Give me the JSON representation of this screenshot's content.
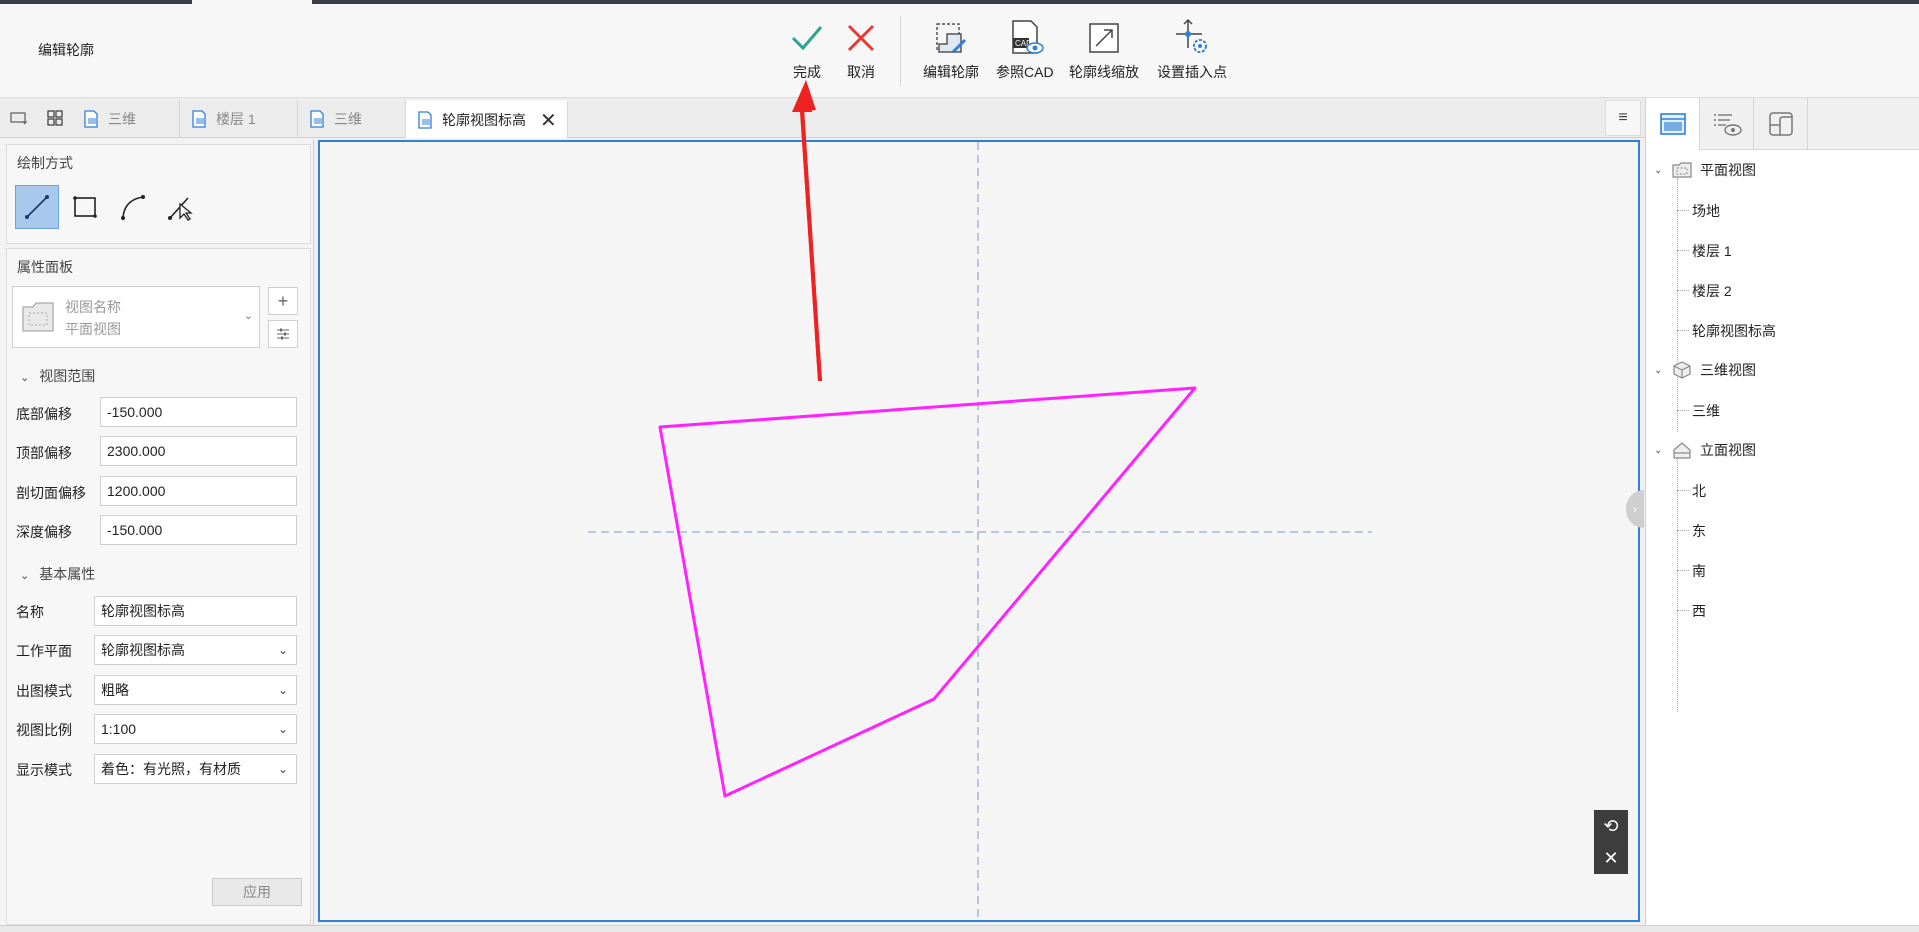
{
  "toolbar": {
    "context_title": "编辑轮廓",
    "finish_label": "完成",
    "cancel_label": "取消",
    "edit_profile_label": "编辑轮廓",
    "ref_cad_label": "参照CAD",
    "scale_profile_label": "轮廓线缩放",
    "set_insert_point_label": "设置插入点"
  },
  "tabs": [
    {
      "label": "三维"
    },
    {
      "label": "楼层 1"
    },
    {
      "label": "三维"
    },
    {
      "label": "轮廓视图标高"
    }
  ],
  "left_panel": {
    "draw_mode_title": "绘制方式",
    "property_panel_title": "属性面板",
    "view_name_placeholder": "视图名称",
    "view_type": "平面视图",
    "group_view_range": "视图范围",
    "group_basic": "基本属性",
    "props": [
      {
        "label": "底部偏移",
        "value": "-150.000"
      },
      {
        "label": "顶部偏移",
        "value": "2300.000"
      },
      {
        "label": "剖切面偏移",
        "value": "1200.000"
      },
      {
        "label": "深度偏移",
        "value": "-150.000"
      }
    ],
    "basic_props": [
      {
        "label": "名称",
        "value": "轮廓视图标高"
      },
      {
        "label": "工作平面",
        "value": "轮廓视图标高"
      },
      {
        "label": "出图模式",
        "value": "粗略"
      },
      {
        "label": "视图比例",
        "value": "1:100"
      },
      {
        "label": "显示模式",
        "value": "着色：有光照，有材质"
      }
    ],
    "apply_label": "应用"
  },
  "right_panel": {
    "groups": [
      {
        "label": "平面视图",
        "items": [
          "场地",
          "楼层 1",
          "楼层 2",
          "轮廓视图标高"
        ]
      },
      {
        "label": "三维视图",
        "items": [
          "三维"
        ]
      },
      {
        "label": "立面视图",
        "items": [
          "北",
          "东",
          "南",
          "西"
        ]
      }
    ]
  },
  "colors": {
    "profile_line": "#ff22ff",
    "accent": "#2f80d6",
    "finish_check": "#2aa58e",
    "cancel_x": "#e53935",
    "annotation_arrow": "#ee2222"
  }
}
